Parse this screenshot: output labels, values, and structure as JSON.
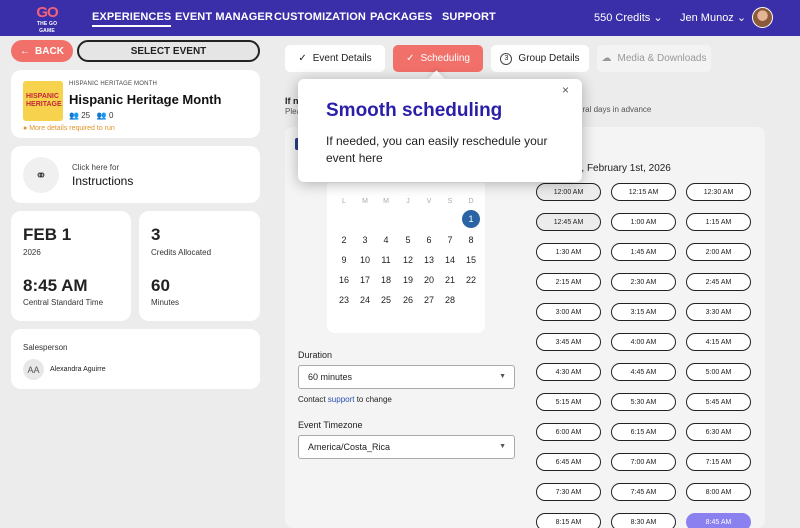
{
  "nav": {
    "logo_mark": "GO",
    "logo_text": "THE GO GAME",
    "links": [
      "EXPERIENCES",
      "EVENT MANAGER",
      "CUSTOMIZATION",
      "PACKAGES",
      "SUPPORT"
    ],
    "credits": "550 Credits",
    "user": "Jen Munoz"
  },
  "sidebar": {
    "back_label": "BACK",
    "select_event_label": "SELECT EVENT",
    "event": {
      "category": "HISPANIC HERITAGE MONTH",
      "title": "Hispanic Heritage Month",
      "participants": "25",
      "teams": "0",
      "warning": "More details required to run",
      "thumb_text": "HISPANIC HERITAGE"
    },
    "instructions": {
      "small": "Click here for",
      "big": "Instructions"
    },
    "date": {
      "day": "FEB 1",
      "year": "2026",
      "time": "8:45 AM",
      "timezone": "Central Standard Time"
    },
    "credits": {
      "value": "3",
      "label": "Credits Allocated",
      "minutes": "60",
      "minutes_label": "Minutes"
    },
    "salesperson": {
      "label": "Salesperson",
      "initials": "AA",
      "name": "Alexandra Aguirre"
    }
  },
  "tabs": [
    {
      "label": "Event Details",
      "icon": "check-icon"
    },
    {
      "label": "Scheduling",
      "icon": "check-icon"
    },
    {
      "label": "Group Details",
      "step": "3"
    },
    {
      "label": "Media & Downloads",
      "icon": "cloud-icon"
    }
  ],
  "main": {
    "hidden_heading": "If n",
    "hidden_sub": "Plea",
    "advance_text": "veral days in advance",
    "date_heading": "day, February 1st, 2026",
    "calendar": {
      "dow": [
        "L",
        "M",
        "M",
        "J",
        "V",
        "S",
        "D"
      ],
      "weeks": [
        [
          "",
          "",
          "",
          "",
          "",
          "",
          "1"
        ],
        [
          "2",
          "3",
          "4",
          "5",
          "6",
          "7",
          "8"
        ],
        [
          "9",
          "10",
          "11",
          "12",
          "13",
          "14",
          "15"
        ],
        [
          "16",
          "17",
          "18",
          "19",
          "20",
          "21",
          "22"
        ],
        [
          "23",
          "24",
          "25",
          "26",
          "27",
          "28",
          ""
        ]
      ],
      "selected": "1"
    },
    "duration_label": "Duration",
    "duration_value": "60 minutes",
    "contact_prefix": "Contact ",
    "contact_link": "support",
    "contact_suffix": " to change",
    "timezone_label": "Event Timezone",
    "timezone_value": "America/Costa_Rica",
    "time_slots": [
      [
        "12:00 AM",
        "12:15 AM",
        "12:30 AM"
      ],
      [
        "12:45 AM",
        "1:00 AM",
        "1:15 AM"
      ],
      [
        "1:30 AM",
        "1:45 AM",
        "2:00 AM"
      ],
      [
        "2:15 AM",
        "2:30 AM",
        "2:45 AM"
      ],
      [
        "3:00 AM",
        "3:15 AM",
        "3:30 AM"
      ],
      [
        "3:45 AM",
        "4:00 AM",
        "4:15 AM"
      ],
      [
        "4:30 AM",
        "4:45 AM",
        "5:00 AM"
      ],
      [
        "5:15 AM",
        "5:30 AM",
        "5:45 AM"
      ],
      [
        "6:00 AM",
        "6:15 AM",
        "6:30 AM"
      ],
      [
        "6:45 AM",
        "7:00 AM",
        "7:15 AM"
      ],
      [
        "7:30 AM",
        "7:45 AM",
        "8:00 AM"
      ],
      [
        "8:15 AM",
        "8:30 AM",
        "8:45 AM"
      ]
    ],
    "selected_slot": "8:45 AM"
  },
  "tooltip": {
    "title": "Smooth scheduling",
    "body": "If needed, you can easily reschedule your event here",
    "close": "×"
  },
  "colors": {
    "nav": "#3a2fa8",
    "accent": "#f2706a",
    "selected_slot": "#8b80f0",
    "calendar_selected": "#2b64a4"
  }
}
